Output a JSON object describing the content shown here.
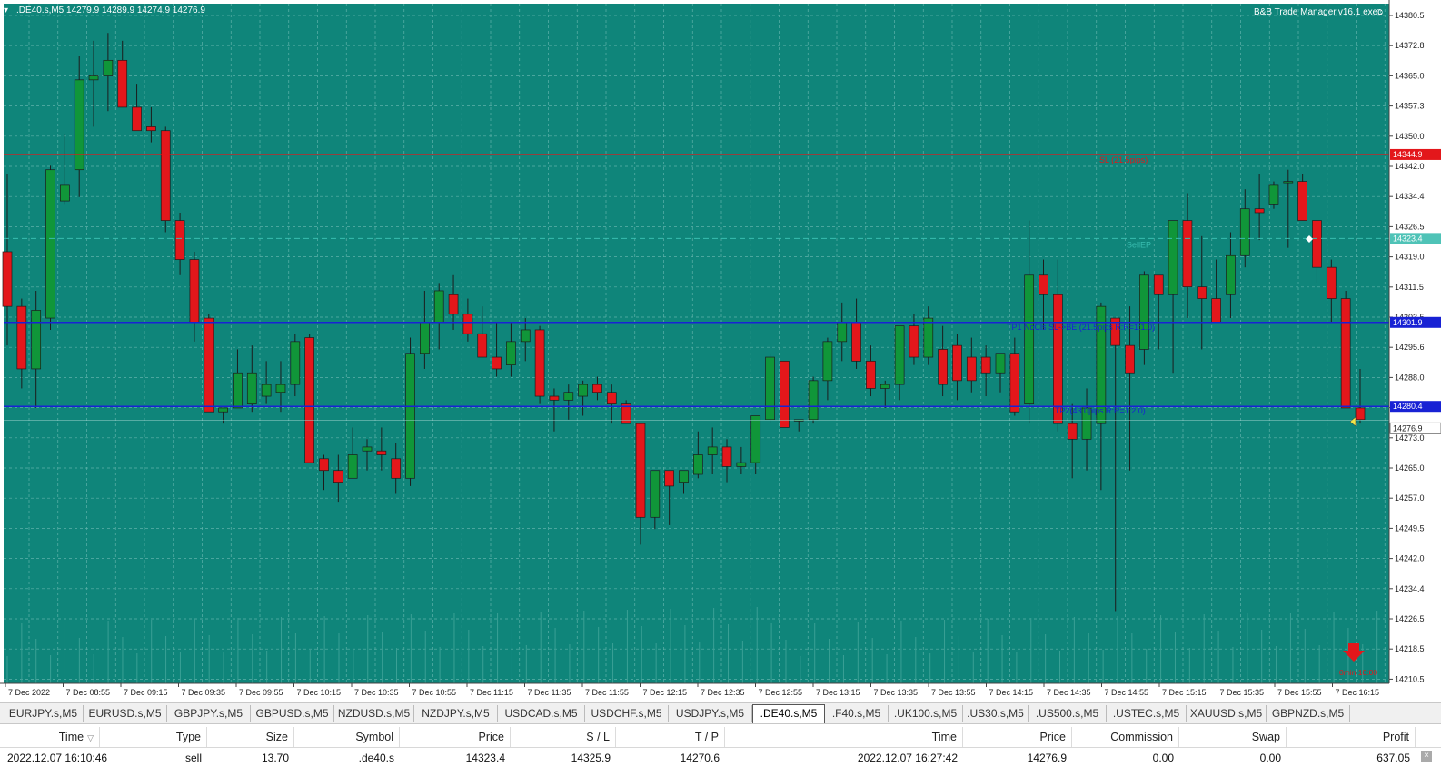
{
  "chart": {
    "header_label": ".DE40.s,M5  14279.9 14289.9 14274.9 14276.9",
    "expert_label": "B&B Trade Manager.v16.1 exec",
    "smile_icon": "smile-icon",
    "background_color": "#0f857a",
    "grid_color": "#5fb2aa",
    "bull_color": "#109639",
    "bear_color": "#e3171b",
    "price_labels": [
      "14380.5",
      "14372.8",
      "14365.0",
      "14357.3",
      "14350.0",
      "14342.0",
      "14334.4",
      "14326.5",
      "14319.0",
      "14311.5",
      "14303.5",
      "14295.6",
      "14288.0",
      "14280.2",
      "14273.0",
      "14265.0",
      "14257.0",
      "14249.5",
      "14242.0",
      "14234.4",
      "14226.5",
      "14218.5",
      "14210.5"
    ],
    "time_labels": [
      "7 Dec 2022",
      "7 Dec 08:55",
      "7 Dec 09:15",
      "7 Dec 09:35",
      "7 Dec 09:55",
      "7 Dec 10:15",
      "7 Dec 10:35",
      "7 Dec 10:55",
      "7 Dec 11:15",
      "7 Dec 11:35",
      "7 Dec 11:55",
      "7 Dec 12:15",
      "7 Dec 12:35",
      "7 Dec 12:55",
      "7 Dec 13:15",
      "7 Dec 13:35",
      "7 Dec 13:55",
      "7 Dec 14:15",
      "7 Dec 14:35",
      "7 Dec 14:55",
      "7 Dec 15:15",
      "7 Dec 15:35",
      "7 Dec 15:55",
      "7 Dec 16:15"
    ],
    "sl_line": {
      "label": "SL (21.5pips)",
      "price_tag": "14344.9",
      "color": "#e3171b"
    },
    "sell_ep": {
      "label": "SellEP",
      "price_tag": "14323.4"
    },
    "tp1_line": {
      "label": "TP1 NoCls SL->BE (21.5pips R:R=1:1.0)",
      "price_tag": "14301.9",
      "color": "#1822d4"
    },
    "tp2_line": {
      "label": "TP2(43.0pips R:R=1:2.0)",
      "price_tag": "14280.4",
      "color": "#1822d4"
    },
    "current_price_tag": "14276.9",
    "timer_label": "0min 10:00",
    "sell_arrow_icon": "down-arrow-icon",
    "candles": [
      [
        14320,
        14340,
        14296,
        14306
      ],
      [
        14306,
        14308,
        14285,
        14290
      ],
      [
        14290,
        14310,
        14280,
        14305
      ],
      [
        14303,
        14342,
        14300,
        14341
      ],
      [
        14333,
        14350,
        14332,
        14337
      ],
      [
        14341,
        14370,
        14334,
        14364
      ],
      [
        14364,
        14374,
        14352,
        14365
      ],
      [
        14365,
        14376,
        14356,
        14369
      ],
      [
        14369,
        14374,
        14357,
        14357
      ],
      [
        14357,
        14363,
        14351,
        14351
      ],
      [
        14352,
        14357,
        14348,
        14351
      ],
      [
        14351,
        14352,
        14325,
        14328
      ],
      [
        14328,
        14330,
        14314,
        14318
      ],
      [
        14318,
        14320,
        14297,
        14302
      ],
      [
        14303,
        14304,
        14280,
        14279
      ],
      [
        14279,
        14280,
        14276,
        14280
      ],
      [
        14280,
        14295,
        14280,
        14289
      ],
      [
        14281,
        14296,
        14279,
        14289
      ],
      [
        14283,
        14292,
        14281,
        14286
      ],
      [
        14284,
        14292,
        14279,
        14286
      ],
      [
        14286,
        14299,
        14283,
        14297
      ],
      [
        14298,
        14299,
        14268,
        14266
      ],
      [
        14267,
        14268,
        14259,
        14264
      ],
      [
        14264,
        14268,
        14256,
        14261
      ],
      [
        14262,
        14275,
        14262,
        14268
      ],
      [
        14269,
        14272,
        14264,
        14270
      ],
      [
        14269,
        14275,
        14264,
        14268
      ],
      [
        14267,
        14271,
        14258,
        14262
      ],
      [
        14262,
        14298,
        14260,
        14294
      ],
      [
        14294,
        14310,
        14290,
        14302
      ],
      [
        14302,
        14312,
        14295,
        14310
      ],
      [
        14309,
        14314,
        14300,
        14304
      ],
      [
        14304,
        14308,
        14297,
        14299
      ],
      [
        14299,
        14306,
        14293,
        14293
      ],
      [
        14293,
        14302,
        14288,
        14290
      ],
      [
        14291,
        14302,
        14288,
        14297
      ],
      [
        14297,
        14303,
        14292,
        14300
      ],
      [
        14300,
        14301,
        14281,
        14283
      ],
      [
        14283,
        14285,
        14274,
        14282
      ],
      [
        14282,
        14286,
        14277,
        14284
      ],
      [
        14283,
        14287,
        14278,
        14286
      ],
      [
        14286,
        14288,
        14282,
        14284
      ],
      [
        14284,
        14286,
        14276,
        14281
      ],
      [
        14281,
        14282,
        14277,
        14276
      ],
      [
        14276,
        14274,
        14245,
        14252
      ],
      [
        14252,
        14262,
        14249,
        14264
      ],
      [
        14264,
        14264,
        14250,
        14260
      ],
      [
        14261,
        14262,
        14258,
        14264
      ],
      [
        14263,
        14274,
        14262,
        14268
      ],
      [
        14268,
        14275,
        14263,
        14270
      ],
      [
        14270,
        14272,
        14261,
        14265
      ],
      [
        14265,
        14270,
        14263,
        14266
      ],
      [
        14266,
        14276,
        14263,
        14278
      ],
      [
        14277,
        14294,
        14276,
        14293
      ],
      [
        14292,
        14292,
        14276,
        14275
      ],
      [
        14277,
        14277,
        14274,
        14277
      ],
      [
        14277,
        14288,
        14276,
        14287
      ],
      [
        14287,
        14298,
        14282,
        14297
      ],
      [
        14297,
        14307,
        14292,
        14302
      ],
      [
        14302,
        14308,
        14290,
        14292
      ],
      [
        14292,
        14296,
        14283,
        14285
      ],
      [
        14285,
        14287,
        14280,
        14286
      ],
      [
        14286,
        14301,
        14282,
        14301
      ],
      [
        14301,
        14304,
        14291,
        14293
      ],
      [
        14293,
        14306,
        14291,
        14303
      ],
      [
        14295,
        14301,
        14283,
        14286
      ],
      [
        14296,
        14299,
        14282,
        14287
      ],
      [
        14293,
        14298,
        14284,
        14287
      ],
      [
        14293,
        14296,
        14283,
        14289
      ],
      [
        14289,
        14293,
        14284,
        14294
      ],
      [
        14294,
        14298,
        14278,
        14279
      ],
      [
        14281,
        14328,
        14276,
        14314
      ],
      [
        14314,
        14318,
        14300,
        14309
      ],
      [
        14309,
        14318,
        14274,
        14276
      ],
      [
        14276,
        14281,
        14262,
        14272
      ],
      [
        14272,
        14285,
        14264,
        14280
      ],
      [
        14276,
        14307,
        14259,
        14306
      ],
      [
        14303,
        14300,
        14228,
        14296
      ],
      [
        14296,
        14306,
        14264,
        14289
      ],
      [
        14295,
        14315,
        14291,
        14314
      ],
      [
        14314,
        14311,
        14295,
        14309
      ],
      [
        14309,
        14327,
        14289,
        14328
      ],
      [
        14328,
        14335,
        14303,
        14311
      ],
      [
        14311,
        14324,
        14295,
        14308
      ],
      [
        14308,
        14318,
        14304,
        14302
      ],
      [
        14309,
        14325,
        14303,
        14319
      ],
      [
        14319,
        14336,
        14316,
        14331
      ],
      [
        14331,
        14340,
        14323,
        14330
      ],
      [
        14332,
        14338,
        14331,
        14337
      ],
      [
        14338,
        14341,
        14321,
        14338
      ],
      [
        14338,
        14340,
        14329,
        14328
      ],
      [
        14328,
        14327,
        14312,
        14316
      ],
      [
        14316,
        14318,
        14302,
        14308
      ],
      [
        14308,
        14310,
        14285,
        14280
      ],
      [
        14280,
        14290,
        14276,
        14277
      ]
    ]
  },
  "symbol_tabs": [
    "EURJPY.s,M5",
    "EURUSD.s,M5",
    "GBPJPY.s,M5",
    "GBPUSD.s,M5",
    "NZDUSD.s,M5",
    "NZDJPY.s,M5",
    "USDCAD.s,M5",
    "USDCHF.s,M5",
    "USDJPY.s,M5",
    ".DE40.s,M5",
    ".F40.s,M5",
    ".UK100.s,M5",
    ".US30.s,M5",
    ".US500.s,M5",
    ".USTEC.s,M5",
    "XAUUSD.s,M5",
    "GBPNZD.s,M5"
  ],
  "active_tab_index": 9,
  "trades": {
    "columns": [
      "Time",
      "Type",
      "Size",
      "Symbol",
      "Price",
      "S / L",
      "T / P",
      "Time",
      "Price",
      "Commission",
      "Swap",
      "Profit"
    ],
    "sort_icon": "sort-desc-icon",
    "rows": [
      [
        "2022.12.07 16:10:46",
        "sell",
        "13.70",
        ".de40.s",
        "14323.4",
        "14325.9",
        "14270.6",
        "2022.12.07 16:27:42",
        "14276.9",
        "0.00",
        "0.00",
        "637.05"
      ]
    ],
    "close_icon": "close-position-icon"
  }
}
